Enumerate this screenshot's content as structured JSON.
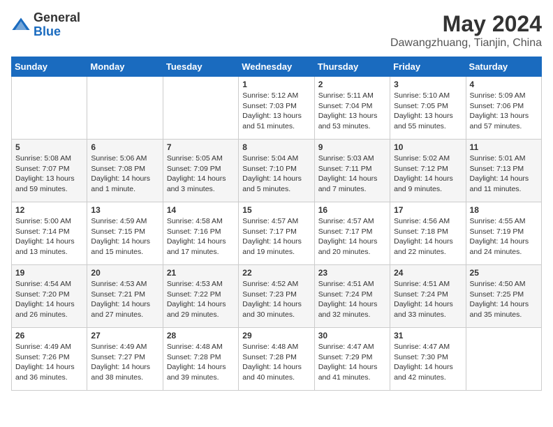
{
  "header": {
    "logo_general": "General",
    "logo_blue": "Blue",
    "title": "May 2024",
    "subtitle": "Dawangzhuang, Tianjin, China"
  },
  "weekdays": [
    "Sunday",
    "Monday",
    "Tuesday",
    "Wednesday",
    "Thursday",
    "Friday",
    "Saturday"
  ],
  "weeks": [
    [
      {
        "day": "",
        "sunrise": "",
        "sunset": "",
        "daylight": ""
      },
      {
        "day": "",
        "sunrise": "",
        "sunset": "",
        "daylight": ""
      },
      {
        "day": "",
        "sunrise": "",
        "sunset": "",
        "daylight": ""
      },
      {
        "day": "1",
        "sunrise": "Sunrise: 5:12 AM",
        "sunset": "Sunset: 7:03 PM",
        "daylight": "Daylight: 13 hours and 51 minutes."
      },
      {
        "day": "2",
        "sunrise": "Sunrise: 5:11 AM",
        "sunset": "Sunset: 7:04 PM",
        "daylight": "Daylight: 13 hours and 53 minutes."
      },
      {
        "day": "3",
        "sunrise": "Sunrise: 5:10 AM",
        "sunset": "Sunset: 7:05 PM",
        "daylight": "Daylight: 13 hours and 55 minutes."
      },
      {
        "day": "4",
        "sunrise": "Sunrise: 5:09 AM",
        "sunset": "Sunset: 7:06 PM",
        "daylight": "Daylight: 13 hours and 57 minutes."
      }
    ],
    [
      {
        "day": "5",
        "sunrise": "Sunrise: 5:08 AM",
        "sunset": "Sunset: 7:07 PM",
        "daylight": "Daylight: 13 hours and 59 minutes."
      },
      {
        "day": "6",
        "sunrise": "Sunrise: 5:06 AM",
        "sunset": "Sunset: 7:08 PM",
        "daylight": "Daylight: 14 hours and 1 minute."
      },
      {
        "day": "7",
        "sunrise": "Sunrise: 5:05 AM",
        "sunset": "Sunset: 7:09 PM",
        "daylight": "Daylight: 14 hours and 3 minutes."
      },
      {
        "day": "8",
        "sunrise": "Sunrise: 5:04 AM",
        "sunset": "Sunset: 7:10 PM",
        "daylight": "Daylight: 14 hours and 5 minutes."
      },
      {
        "day": "9",
        "sunrise": "Sunrise: 5:03 AM",
        "sunset": "Sunset: 7:11 PM",
        "daylight": "Daylight: 14 hours and 7 minutes."
      },
      {
        "day": "10",
        "sunrise": "Sunrise: 5:02 AM",
        "sunset": "Sunset: 7:12 PM",
        "daylight": "Daylight: 14 hours and 9 minutes."
      },
      {
        "day": "11",
        "sunrise": "Sunrise: 5:01 AM",
        "sunset": "Sunset: 7:13 PM",
        "daylight": "Daylight: 14 hours and 11 minutes."
      }
    ],
    [
      {
        "day": "12",
        "sunrise": "Sunrise: 5:00 AM",
        "sunset": "Sunset: 7:14 PM",
        "daylight": "Daylight: 14 hours and 13 minutes."
      },
      {
        "day": "13",
        "sunrise": "Sunrise: 4:59 AM",
        "sunset": "Sunset: 7:15 PM",
        "daylight": "Daylight: 14 hours and 15 minutes."
      },
      {
        "day": "14",
        "sunrise": "Sunrise: 4:58 AM",
        "sunset": "Sunset: 7:16 PM",
        "daylight": "Daylight: 14 hours and 17 minutes."
      },
      {
        "day": "15",
        "sunrise": "Sunrise: 4:57 AM",
        "sunset": "Sunset: 7:17 PM",
        "daylight": "Daylight: 14 hours and 19 minutes."
      },
      {
        "day": "16",
        "sunrise": "Sunrise: 4:57 AM",
        "sunset": "Sunset: 7:17 PM",
        "daylight": "Daylight: 14 hours and 20 minutes."
      },
      {
        "day": "17",
        "sunrise": "Sunrise: 4:56 AM",
        "sunset": "Sunset: 7:18 PM",
        "daylight": "Daylight: 14 hours and 22 minutes."
      },
      {
        "day": "18",
        "sunrise": "Sunrise: 4:55 AM",
        "sunset": "Sunset: 7:19 PM",
        "daylight": "Daylight: 14 hours and 24 minutes."
      }
    ],
    [
      {
        "day": "19",
        "sunrise": "Sunrise: 4:54 AM",
        "sunset": "Sunset: 7:20 PM",
        "daylight": "Daylight: 14 hours and 26 minutes."
      },
      {
        "day": "20",
        "sunrise": "Sunrise: 4:53 AM",
        "sunset": "Sunset: 7:21 PM",
        "daylight": "Daylight: 14 hours and 27 minutes."
      },
      {
        "day": "21",
        "sunrise": "Sunrise: 4:53 AM",
        "sunset": "Sunset: 7:22 PM",
        "daylight": "Daylight: 14 hours and 29 minutes."
      },
      {
        "day": "22",
        "sunrise": "Sunrise: 4:52 AM",
        "sunset": "Sunset: 7:23 PM",
        "daylight": "Daylight: 14 hours and 30 minutes."
      },
      {
        "day": "23",
        "sunrise": "Sunrise: 4:51 AM",
        "sunset": "Sunset: 7:24 PM",
        "daylight": "Daylight: 14 hours and 32 minutes."
      },
      {
        "day": "24",
        "sunrise": "Sunrise: 4:51 AM",
        "sunset": "Sunset: 7:24 PM",
        "daylight": "Daylight: 14 hours and 33 minutes."
      },
      {
        "day": "25",
        "sunrise": "Sunrise: 4:50 AM",
        "sunset": "Sunset: 7:25 PM",
        "daylight": "Daylight: 14 hours and 35 minutes."
      }
    ],
    [
      {
        "day": "26",
        "sunrise": "Sunrise: 4:49 AM",
        "sunset": "Sunset: 7:26 PM",
        "daylight": "Daylight: 14 hours and 36 minutes."
      },
      {
        "day": "27",
        "sunrise": "Sunrise: 4:49 AM",
        "sunset": "Sunset: 7:27 PM",
        "daylight": "Daylight: 14 hours and 38 minutes."
      },
      {
        "day": "28",
        "sunrise": "Sunrise: 4:48 AM",
        "sunset": "Sunset: 7:28 PM",
        "daylight": "Daylight: 14 hours and 39 minutes."
      },
      {
        "day": "29",
        "sunrise": "Sunrise: 4:48 AM",
        "sunset": "Sunset: 7:28 PM",
        "daylight": "Daylight: 14 hours and 40 minutes."
      },
      {
        "day": "30",
        "sunrise": "Sunrise: 4:47 AM",
        "sunset": "Sunset: 7:29 PM",
        "daylight": "Daylight: 14 hours and 41 minutes."
      },
      {
        "day": "31",
        "sunrise": "Sunrise: 4:47 AM",
        "sunset": "Sunset: 7:30 PM",
        "daylight": "Daylight: 14 hours and 42 minutes."
      },
      {
        "day": "",
        "sunrise": "",
        "sunset": "",
        "daylight": ""
      }
    ]
  ]
}
